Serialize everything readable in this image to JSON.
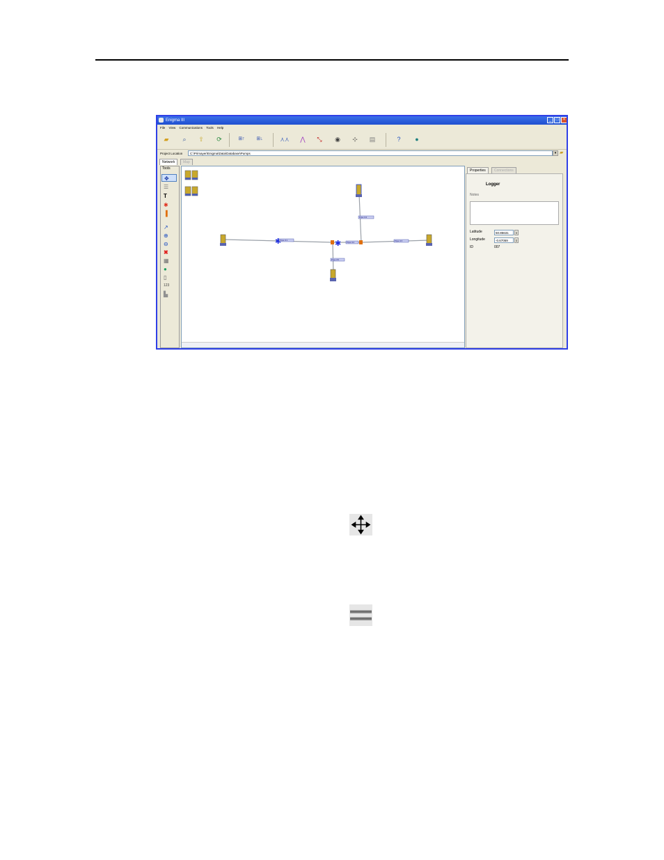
{
  "window": {
    "title": "Enigma III",
    "controls": [
      "_",
      "□",
      "×"
    ]
  },
  "menu": [
    "File",
    "View",
    "Communications",
    "Tools",
    "Help"
  ],
  "toolbar": {
    "icons": [
      "open-folder-icon",
      "find-icon",
      "upload-icon",
      "refresh-icon",
      "send-up-icon",
      "send-down-icon",
      "chart-icon",
      "chart-peak-icon",
      "chart-line-icon",
      "disc-icon",
      "network-icon",
      "print-icon",
      "help-icon",
      "globe-icon"
    ]
  },
  "location": {
    "label": "Project Location",
    "value": "C:\\Primayer\\Enigma\\Data\\Database\\Pumps"
  },
  "tabs": [
    {
      "label": "Network",
      "active": true
    },
    {
      "label": "Map",
      "active": false
    }
  ],
  "tools_panel": {
    "title": "Tools",
    "items": [
      "move-tool-icon",
      "pipe-tool-icon",
      "text-tool-icon",
      "junction-tool-icon",
      "valve-tool-icon",
      "pointer-tool-icon",
      "zoom-in-tool-icon",
      "zoom-out-tool-icon",
      "delete-tool-icon",
      "grid-tool-icon",
      "globe-tool-icon",
      "logger-tool-icon",
      "counter-tool-icon",
      "chart-tool-icon"
    ]
  },
  "network": {
    "pipe_labels": [
      "Pipe 01",
      "Pipe 02",
      "Pipe 03",
      "Pipe 04",
      "Pipe 05"
    ]
  },
  "properties": {
    "tabs": [
      "Properties",
      "Connections"
    ],
    "title": "Logger",
    "notes_label": "Notes",
    "latitude_label": "Latitude",
    "latitude_value": "50.85631",
    "longitude_label": "Longitude",
    "longitude_value": "-0.67059",
    "id_label": "ID",
    "id_value": "007"
  },
  "colors": {
    "window_border": "#2f3fe6",
    "titlebar": "#1f4fd0",
    "accent_red": "#e0301e",
    "accent_blue": "#2030e0"
  }
}
